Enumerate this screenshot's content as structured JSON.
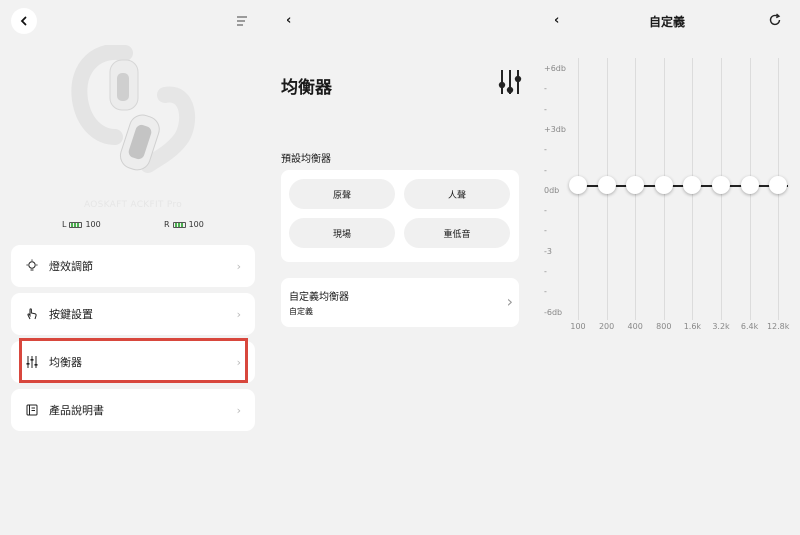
{
  "device": {
    "model_name": "AOSKAFT ACKFIT Pro",
    "left_label": "L",
    "left_battery": "100",
    "right_label": "R",
    "right_battery": "100"
  },
  "menu": {
    "items": [
      {
        "label": "燈效調節",
        "icon": "lightbulb-icon"
      },
      {
        "label": "按鍵設置",
        "icon": "hand-tap-icon"
      },
      {
        "label": "均衡器",
        "icon": "equalizer-icon"
      },
      {
        "label": "產品說明書",
        "icon": "book-icon"
      }
    ],
    "chevron": "›"
  },
  "equalizer_page": {
    "back": "‹",
    "title": "均衡器",
    "preset_heading": "預設均衡器",
    "presets": [
      "原聲",
      "人聲",
      "現場",
      "重低音"
    ],
    "custom_title": "自定義均衡器",
    "custom_value": "自定義",
    "chevron": "›"
  },
  "custom_page": {
    "back": "‹",
    "title": "自定義",
    "db_labels": [
      "+6db",
      "-",
      "-",
      "+3db",
      "-",
      "-",
      "0db",
      "-",
      "-",
      "-3",
      "-",
      "-",
      "-6db"
    ],
    "bands": [
      {
        "freq": "100",
        "gain": 0
      },
      {
        "freq": "200",
        "gain": 0
      },
      {
        "freq": "400",
        "gain": 0
      },
      {
        "freq": "800",
        "gain": 0
      },
      {
        "freq": "1.6k",
        "gain": 0
      },
      {
        "freq": "3.2k",
        "gain": 0
      },
      {
        "freq": "6.4k",
        "gain": 0
      },
      {
        "freq": "12.8k",
        "gain": 0
      }
    ]
  },
  "colors": {
    "highlight": "#d8473d",
    "battery": "#4caf50"
  }
}
